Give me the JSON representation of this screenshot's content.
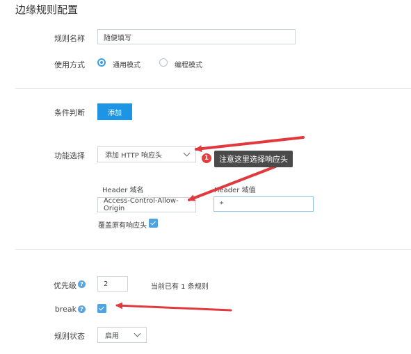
{
  "page_title": "边缘规则配置",
  "rule_name": {
    "label": "规则名称",
    "value": "随便填写"
  },
  "usage_mode": {
    "label": "使用方式",
    "options": [
      {
        "label": "通用模式",
        "selected": true
      },
      {
        "label": "编程模式",
        "selected": false
      }
    ]
  },
  "condition": {
    "label": "条件判断",
    "add_button": "添加"
  },
  "function_select": {
    "label": "功能选择",
    "selected": "添加 HTTP 响应头"
  },
  "header": {
    "name_label": "Header 域名",
    "name_value": "Access-Control-Allow-Origin",
    "value_label": "Header 域值",
    "value_value": "*",
    "override_label": "覆盖原有响应头",
    "override_checked": true
  },
  "priority": {
    "label": "优先级",
    "value": "2",
    "note": "当前已有 1 条规则"
  },
  "break": {
    "label": "break",
    "checked": true
  },
  "rule_status": {
    "label": "规则状态",
    "selected": "启用"
  },
  "annotation": {
    "badge": "1",
    "text": "注意这里选择响应头"
  },
  "colors": {
    "accent": "#1e94e5",
    "arrow": "#e0393e",
    "tooltip_bg": "#4a4a4a"
  },
  "icons": {
    "help": "question-circle-icon",
    "dropdown": "chevron-down-icon",
    "check": "checkmark-icon"
  }
}
